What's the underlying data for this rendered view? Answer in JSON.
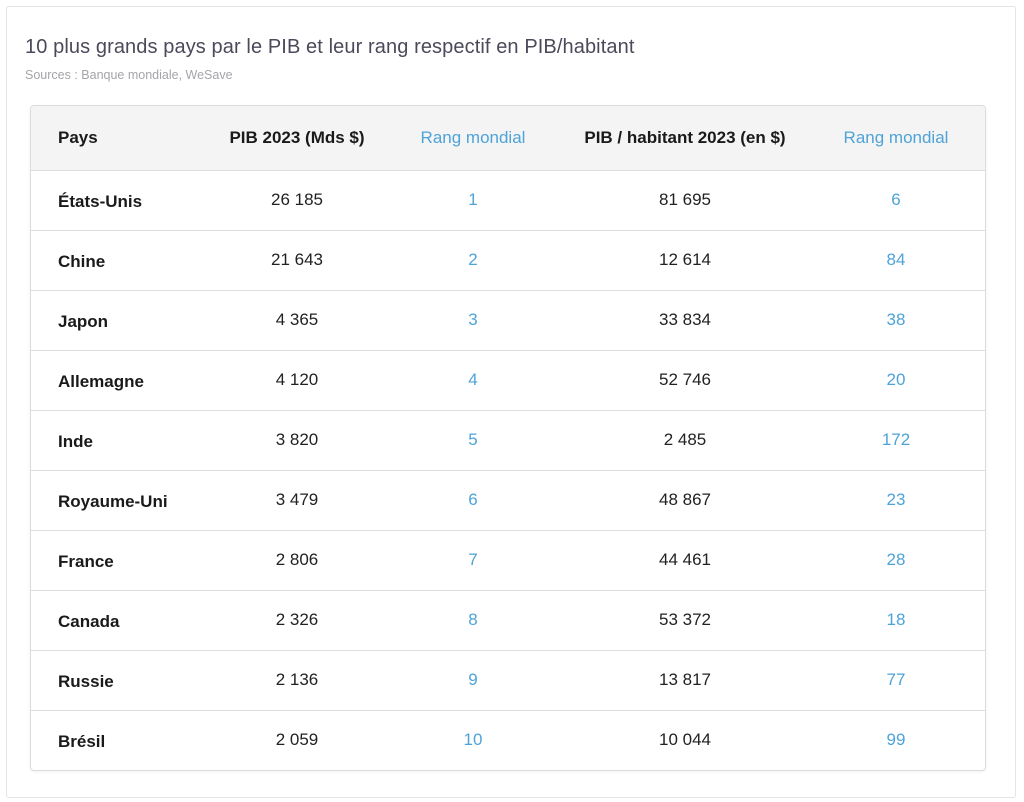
{
  "header": {
    "title": "10 plus grands pays par le PIB et leur rang respectif en PIB/habitant",
    "sources": "Sources : Banque mondiale, WeSave"
  },
  "table": {
    "columns": [
      "Pays",
      "PIB 2023 (Mds $)",
      "Rang mondial",
      "PIB / habitant 2023 (en $)",
      "Rang mondial"
    ],
    "rows": [
      {
        "country": "États-Unis",
        "gdp": "26 185",
        "gdp_rank": "1",
        "gdp_per_capita": "81 695",
        "per_capita_rank": "6"
      },
      {
        "country": "Chine",
        "gdp": "21 643",
        "gdp_rank": "2",
        "gdp_per_capita": "12 614",
        "per_capita_rank": "84"
      },
      {
        "country": "Japon",
        "gdp": "4 365",
        "gdp_rank": "3",
        "gdp_per_capita": "33 834",
        "per_capita_rank": "38"
      },
      {
        "country": "Allemagne",
        "gdp": "4 120",
        "gdp_rank": "4",
        "gdp_per_capita": "52 746",
        "per_capita_rank": "20"
      },
      {
        "country": "Inde",
        "gdp": "3 820",
        "gdp_rank": "5",
        "gdp_per_capita": "2 485",
        "per_capita_rank": "172"
      },
      {
        "country": "Royaume-Uni",
        "gdp": "3 479",
        "gdp_rank": "6",
        "gdp_per_capita": "48 867",
        "per_capita_rank": "23"
      },
      {
        "country": "France",
        "gdp": "2 806",
        "gdp_rank": "7",
        "gdp_per_capita": "44 461",
        "per_capita_rank": "28"
      },
      {
        "country": "Canada",
        "gdp": "2 326",
        "gdp_rank": "8",
        "gdp_per_capita": "53 372",
        "per_capita_rank": "18"
      },
      {
        "country": "Russie",
        "gdp": "2 136",
        "gdp_rank": "9",
        "gdp_per_capita": "13 817",
        "per_capita_rank": "77"
      },
      {
        "country": "Brésil",
        "gdp": "2 059",
        "gdp_rank": "10",
        "gdp_per_capita": "10 044",
        "per_capita_rank": "99"
      }
    ]
  },
  "colors": {
    "rank_accent": "#4ea3d8",
    "header_background": "#f4f4f4",
    "title_text": "#4a4a5a",
    "sources_text": "#a4a4aa"
  }
}
